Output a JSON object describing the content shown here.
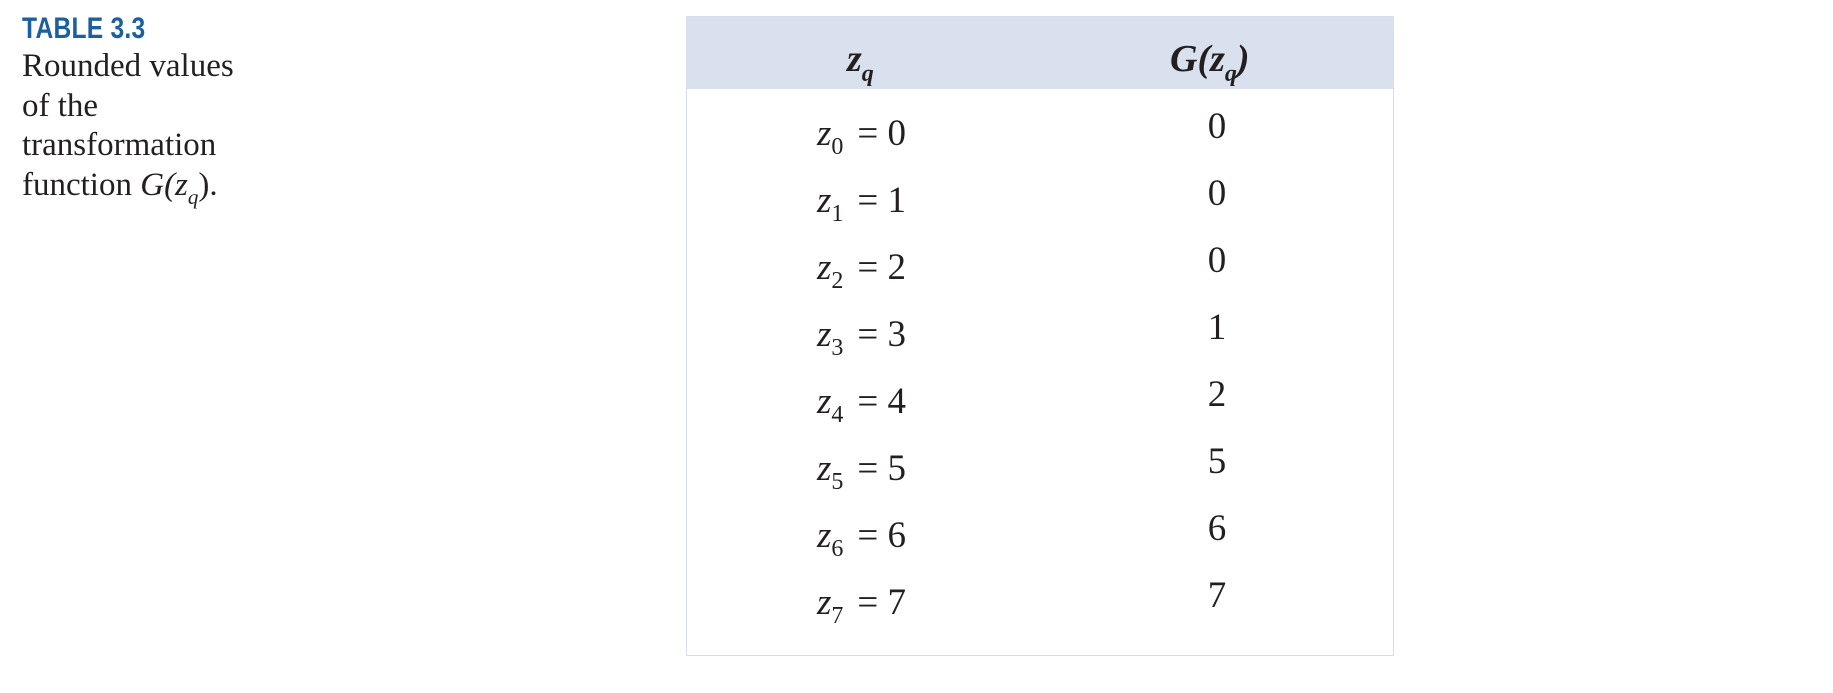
{
  "caption": {
    "label": "TABLE 3.3",
    "lines": [
      "Rounded values",
      "of the",
      "transformation",
      "function"
    ],
    "function_name": "G(z",
    "function_sub": "q",
    "function_close": ")."
  },
  "table": {
    "headers": {
      "zq_var": "z",
      "zq_sub": "q",
      "g_open": "G(z",
      "g_sub": "q",
      "g_close": ")"
    },
    "rows": [
      {
        "var": "z",
        "sub": "0",
        "eq": "= 0",
        "g": "0"
      },
      {
        "var": "z",
        "sub": "1",
        "eq": "= 1",
        "g": "0"
      },
      {
        "var": "z",
        "sub": "2",
        "eq": "= 2",
        "g": "0"
      },
      {
        "var": "z",
        "sub": "3",
        "eq": "= 3",
        "g": "1"
      },
      {
        "var": "z",
        "sub": "4",
        "eq": "= 4",
        "g": "2"
      },
      {
        "var": "z",
        "sub": "5",
        "eq": "= 5",
        "g": "5"
      },
      {
        "var": "z",
        "sub": "6",
        "eq": "= 6",
        "g": "6"
      },
      {
        "var": "z",
        "sub": "7",
        "eq": "= 7",
        "g": "7"
      }
    ]
  }
}
